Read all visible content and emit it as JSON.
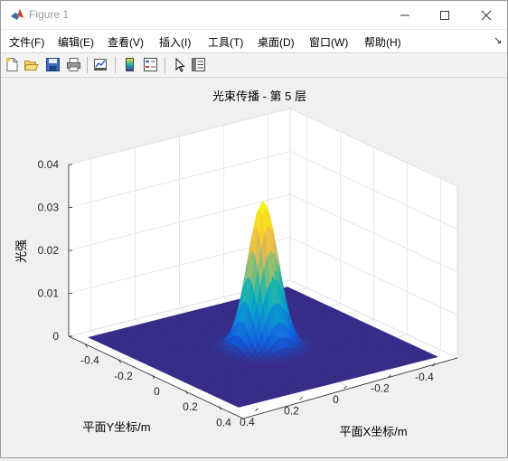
{
  "window": {
    "title": "Figure 1"
  },
  "menu": {
    "file": "文件(F)",
    "edit": "编辑(E)",
    "view": "查看(V)",
    "insert": "插入(I)",
    "tools": "工具(T)",
    "desktop": "桌面(D)",
    "window": "窗口(W)",
    "help": "帮助(H)"
  },
  "toolbar": {
    "icons": [
      "new-figure-icon",
      "open-file-icon",
      "save-icon",
      "print-icon",
      "link-plot-icon",
      "insert-colorbar-icon",
      "insert-legend-icon",
      "edit-plot-icon",
      "property-inspector-icon"
    ]
  },
  "plot": {
    "title": "光束传播 - 第 5 层",
    "xlabel": "平面X坐标/m",
    "ylabel": "平面Y坐标/m",
    "zlabel": "光强",
    "colormap": "parula"
  },
  "chart_data": {
    "type": "surface",
    "title": "光束传播 - 第 5 层",
    "xlabel": "平面X坐标/m",
    "ylabel": "平面Y坐标/m",
    "zlabel": "光强",
    "xlim": [
      -0.5,
      0.5
    ],
    "ylim": [
      -0.5,
      0.5
    ],
    "zlim": [
      0,
      0.04
    ],
    "xticks": [
      "-0.4",
      "-0.2",
      "0",
      "0.2",
      "0.4"
    ],
    "yticks": [
      "-0.4",
      "-0.2",
      "0",
      "0.2",
      "0.4"
    ],
    "zticks": [
      "0",
      "0.01",
      "0.02",
      "0.03",
      "0.04"
    ],
    "grid": true,
    "surface": {
      "shape": "gaussian",
      "center": [
        0,
        0
      ],
      "peak": 0.034,
      "sigma": 0.055,
      "extent": [
        -0.45,
        0.45
      ]
    }
  }
}
